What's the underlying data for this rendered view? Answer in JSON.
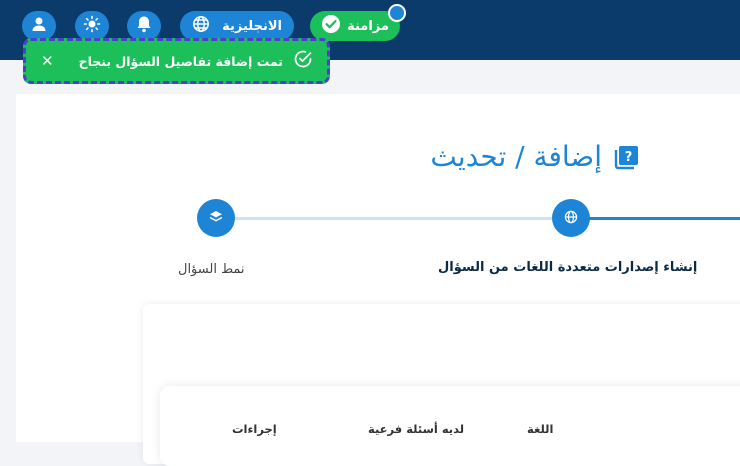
{
  "topbar": {
    "language_label": "الانجليزية",
    "sync_label": "مزامنة"
  },
  "toast": {
    "message": "تمت إضافة تفاصيل السؤال بنجاح",
    "close_label": "✕"
  },
  "page": {
    "title": "إضافة / تحديث"
  },
  "stepper": {
    "steps": [
      {
        "label": "نمط السؤال",
        "icon": "layers-icon"
      },
      {
        "label": "إنشاء إصدارات متعددة اللغات من السؤال",
        "icon": "globe-icon"
      }
    ]
  },
  "table": {
    "headers": [
      "إجراءات",
      "لديه أسئلة فرعية",
      "اللغة"
    ]
  },
  "colors": {
    "topbar": "#0b3b6a",
    "accent": "#1d84d6",
    "success": "#1cbf5a",
    "toast_border": "#4b3fd1"
  }
}
